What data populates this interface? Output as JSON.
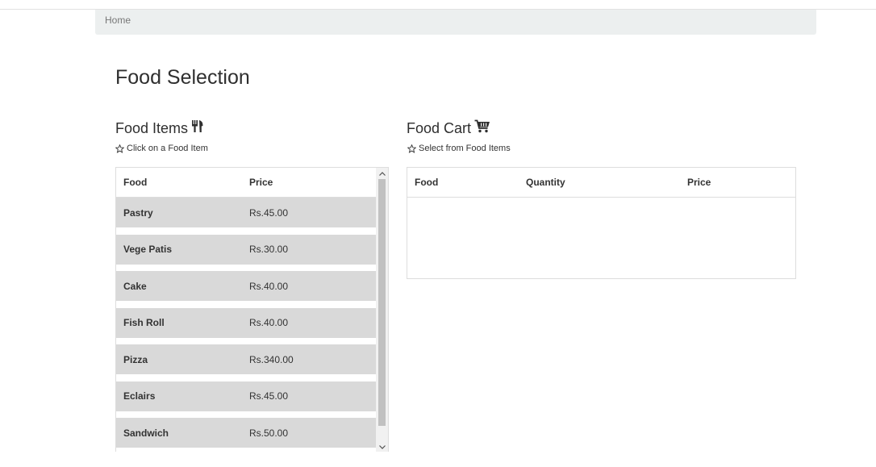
{
  "breadcrumb": {
    "home": "Home"
  },
  "page": {
    "title": "Food Selection"
  },
  "food_items": {
    "title": "Food Items",
    "title_icon": "utensils-icon",
    "hint_icon": "star-outline-icon",
    "hint": "Click on a Food Item",
    "columns": {
      "food": "Food",
      "price": "Price"
    },
    "rows": [
      {
        "food": "Pastry",
        "price": "Rs.45.00"
      },
      {
        "food": "Vege Patis",
        "price": "Rs.30.00"
      },
      {
        "food": "Cake",
        "price": "Rs.40.00"
      },
      {
        "food": "Fish Roll",
        "price": "Rs.40.00"
      },
      {
        "food": "Pizza",
        "price": "Rs.340.00"
      },
      {
        "food": "Eclairs",
        "price": "Rs.45.00"
      },
      {
        "food": "Sandwich",
        "price": "Rs.50.00"
      }
    ]
  },
  "food_cart": {
    "title": "Food Cart",
    "title_icon": "shopping-cart-icon",
    "hint_icon": "star-outline-icon",
    "hint": "Select from Food Items",
    "columns": {
      "food": "Food",
      "quantity": "Quantity",
      "price": "Price"
    },
    "rows": []
  },
  "colors": {
    "row_background": "#d9d9d9",
    "breadcrumb_background": "#ecefef",
    "border": "#dddddd"
  }
}
